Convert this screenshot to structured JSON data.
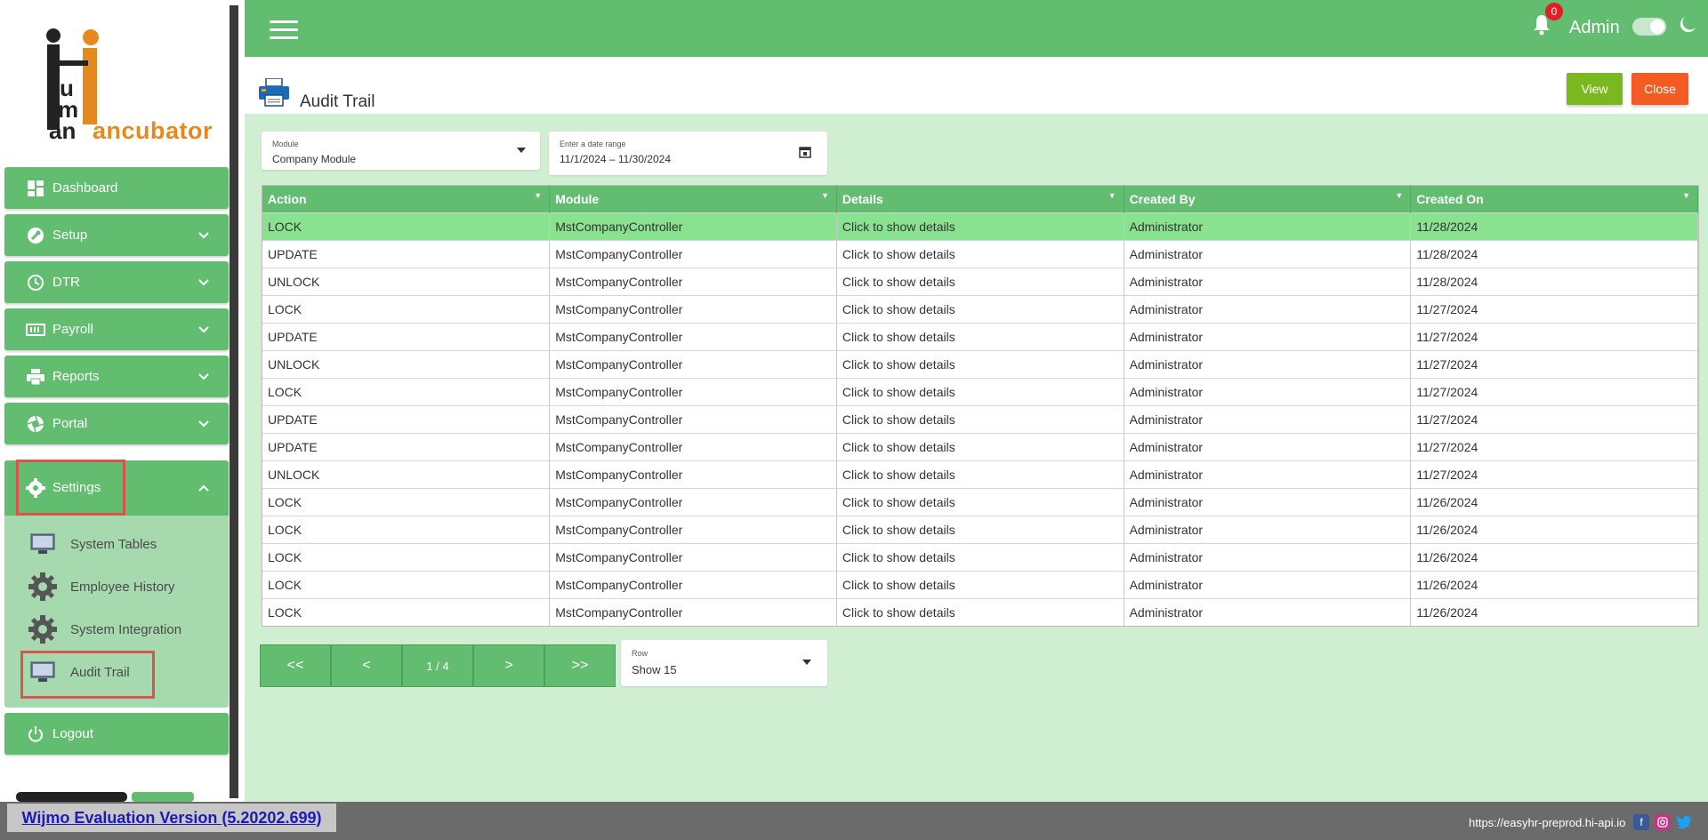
{
  "app": {
    "logo_text": "ancubator",
    "logo_letters": "Hum",
    "notification_count": "0",
    "user_label": "Admin"
  },
  "sidebar": {
    "items": [
      {
        "label": "Dashboard",
        "icon": "dashboard-icon",
        "has_chevron": false
      },
      {
        "label": "Setup",
        "icon": "wrench-icon",
        "has_chevron": true
      },
      {
        "label": "DTR",
        "icon": "clock-icon",
        "has_chevron": true
      },
      {
        "label": "Payroll",
        "icon": "money-icon",
        "has_chevron": true
      },
      {
        "label": "Reports",
        "icon": "printer-icon",
        "has_chevron": true
      },
      {
        "label": "Portal",
        "icon": "aperture-icon",
        "has_chevron": true
      }
    ],
    "settings": {
      "label": "Settings",
      "sub_items": [
        {
          "label": "System Tables",
          "icon": "monitor-icon"
        },
        {
          "label": "Employee History",
          "icon": "gear-icon"
        },
        {
          "label": "System Integration",
          "icon": "gear-icon"
        },
        {
          "label": "Audit Trail",
          "icon": "monitor-icon"
        }
      ]
    },
    "logout_label": "Logout"
  },
  "page": {
    "title": "Audit Trail",
    "view_label": "View",
    "close_label": "Close"
  },
  "filters": {
    "module_label": "Module",
    "module_value": "Company Module",
    "date_label": "Enter a date range",
    "date_value": "11/1/2024 – 11/30/2024"
  },
  "grid": {
    "columns": [
      "Action",
      "Module",
      "Details",
      "Created By",
      "Created On"
    ],
    "rows": [
      [
        "LOCK",
        "MstCompanyController",
        "Click to show details",
        "Administrator",
        "11/28/2024"
      ],
      [
        "UPDATE",
        "MstCompanyController",
        "Click to show details",
        "Administrator",
        "11/28/2024"
      ],
      [
        "UNLOCK",
        "MstCompanyController",
        "Click to show details",
        "Administrator",
        "11/28/2024"
      ],
      [
        "LOCK",
        "MstCompanyController",
        "Click to show details",
        "Administrator",
        "11/27/2024"
      ],
      [
        "UPDATE",
        "MstCompanyController",
        "Click to show details",
        "Administrator",
        "11/27/2024"
      ],
      [
        "UNLOCK",
        "MstCompanyController",
        "Click to show details",
        "Administrator",
        "11/27/2024"
      ],
      [
        "LOCK",
        "MstCompanyController",
        "Click to show details",
        "Administrator",
        "11/27/2024"
      ],
      [
        "UPDATE",
        "MstCompanyController",
        "Click to show details",
        "Administrator",
        "11/27/2024"
      ],
      [
        "UPDATE",
        "MstCompanyController",
        "Click to show details",
        "Administrator",
        "11/27/2024"
      ],
      [
        "UNLOCK",
        "MstCompanyController",
        "Click to show details",
        "Administrator",
        "11/27/2024"
      ],
      [
        "LOCK",
        "MstCompanyController",
        "Click to show details",
        "Administrator",
        "11/26/2024"
      ],
      [
        "LOCK",
        "MstCompanyController",
        "Click to show details",
        "Administrator",
        "11/26/2024"
      ],
      [
        "LOCK",
        "MstCompanyController",
        "Click to show details",
        "Administrator",
        "11/26/2024"
      ],
      [
        "LOCK",
        "MstCompanyController",
        "Click to show details",
        "Administrator",
        "11/26/2024"
      ],
      [
        "LOCK",
        "MstCompanyController",
        "Click to show details",
        "Administrator",
        "11/26/2024"
      ]
    ]
  },
  "pager": {
    "first": "<<",
    "prev": "<",
    "page": "1 / 4",
    "next": ">",
    "last": ">>"
  },
  "rows_select": {
    "label": "Row",
    "value": "Show 15"
  },
  "footer": {
    "wijmo_text": "Wijmo Evaluation Version (5.20202.699)",
    "url": "https://easyhr-preprod.hi-api.io"
  },
  "colors": {
    "primary_green": "#62bd71",
    "light_green": "#d0eed2",
    "view_button": "#7ab81f",
    "close_button": "#f25c23",
    "selected_row": "#88e28f"
  }
}
